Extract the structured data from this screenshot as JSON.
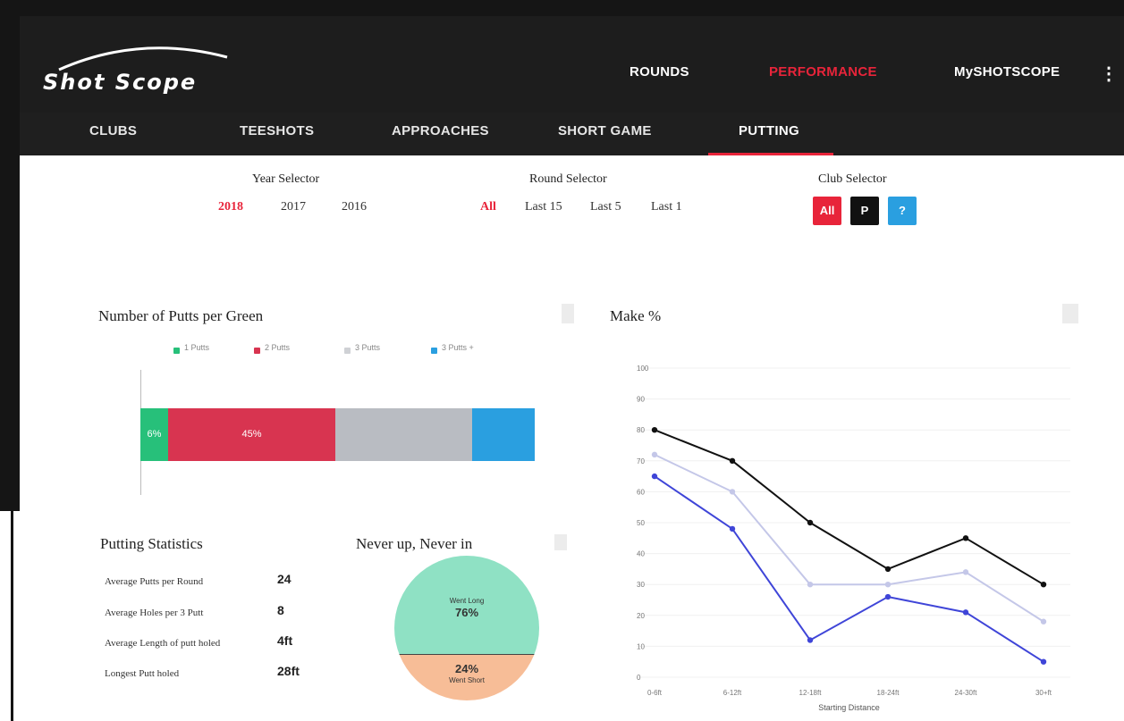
{
  "app": {
    "logo_text": "Shot Scope"
  },
  "nav": {
    "items": [
      {
        "label": "ROUNDS",
        "active": false
      },
      {
        "label": "PERFORMANCE",
        "active": true
      },
      {
        "label": "MySHOTSCOPE",
        "active": false
      }
    ],
    "more_icon": "kebab-menu-icon"
  },
  "subnav": {
    "tabs": [
      {
        "label": "CLUBS",
        "active": false
      },
      {
        "label": "TEESHOTS",
        "active": false
      },
      {
        "label": "APPROACHES",
        "active": false
      },
      {
        "label": "SHORT GAME",
        "active": false
      },
      {
        "label": "PUTTING",
        "active": true
      }
    ]
  },
  "selectors": {
    "year": {
      "title": "Year Selector",
      "options": [
        "2018",
        "2017",
        "2016"
      ],
      "selected": "2018"
    },
    "round": {
      "title": "Round Selector",
      "options": [
        "All",
        "Last 15",
        "Last 5",
        "Last 1"
      ],
      "selected": "All"
    },
    "club": {
      "title": "Club Selector",
      "options": [
        {
          "label": "All",
          "color": "#e8243a"
        },
        {
          "label": "P",
          "color": "#111111"
        },
        {
          "label": "?",
          "color": "#2a9fe0"
        }
      ],
      "selected": "All"
    }
  },
  "putts_card": {
    "title": "Number of Putts per Green",
    "legend": [
      "1 Putts",
      "2 Putts",
      "3 Putts",
      "3 Putts +"
    ],
    "colors": [
      "#27c07a",
      "#d83450",
      "#b9bcc2",
      "#2a9fe0"
    ],
    "segment_labels": [
      "6%",
      "45%",
      "",
      ""
    ],
    "segment_fractions": [
      0.071,
      0.425,
      0.346,
      0.158
    ]
  },
  "stats_card": {
    "title": "Putting Statistics",
    "rows": [
      {
        "label": "Average Putts per Round",
        "value": "24"
      },
      {
        "label": "Average Holes per 3 Putt",
        "value": "8"
      },
      {
        "label": "Average Length of putt holed",
        "value": "4ft"
      },
      {
        "label": "Longest Putt holed",
        "value": "28ft"
      }
    ]
  },
  "never_up_card": {
    "title": "Never up, Never in",
    "top_label": "Went Long",
    "top_value": "76%",
    "bottom_value": "24%",
    "bottom_label": "Went Short"
  },
  "make_card": {
    "title": "Make %",
    "chart_data": {
      "type": "line",
      "title": "Make %",
      "xlabel": "Starting Distance",
      "ylabel": "",
      "categories": [
        "0-6ft",
        "6-12ft",
        "12-18ft",
        "18-24ft",
        "24-30ft",
        "30+ft"
      ],
      "ylim": [
        0,
        100
      ],
      "yticks": [
        100,
        90,
        80,
        70,
        60,
        50,
        40,
        30,
        20,
        10,
        0
      ],
      "series": [
        {
          "color": "#111111",
          "values": [
            80,
            70,
            50,
            35,
            45,
            30
          ]
        },
        {
          "color": "#c4c7e8",
          "values": [
            72,
            60,
            30,
            30,
            34,
            18
          ]
        },
        {
          "color": "#3f45d8",
          "values": [
            65,
            48,
            12,
            26,
            21,
            5
          ]
        }
      ],
      "grid": true
    }
  }
}
